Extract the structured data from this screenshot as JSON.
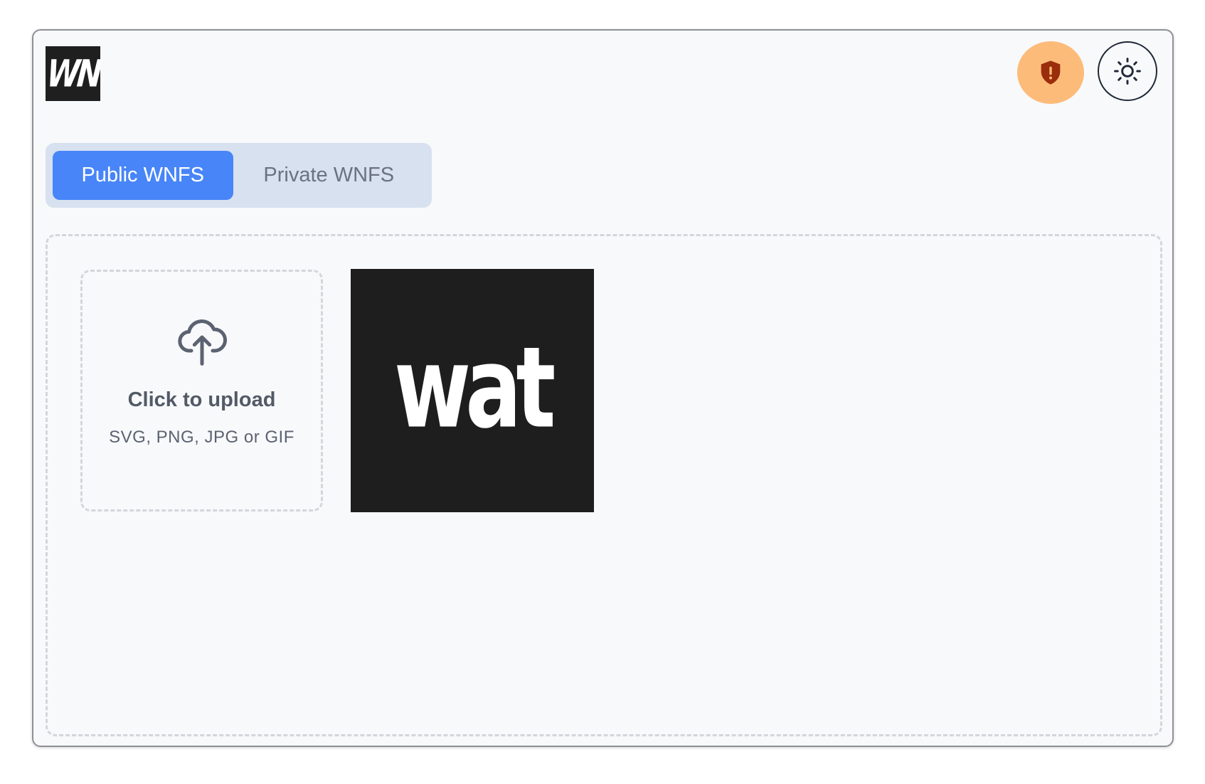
{
  "header": {
    "logo_text": "WN",
    "shield_icon": "shield-alert-icon",
    "theme_icon": "sun-icon",
    "colors": {
      "shield_bg": "#fdbb7a",
      "shield_fg": "#9a2d0c"
    }
  },
  "tabs": [
    {
      "label": "Public WNFS",
      "active": true
    },
    {
      "label": "Private WNFS",
      "active": false
    }
  ],
  "colors": {
    "accent": "#4785f8",
    "tabs_bg": "#d7e1ef"
  },
  "upload": {
    "icon": "cloud-upload-icon",
    "title": "Click to upload",
    "hint": "SVG, PNG, JPG or GIF"
  },
  "gallery": {
    "items": [
      {
        "thumbnail_text": "wat"
      }
    ]
  }
}
